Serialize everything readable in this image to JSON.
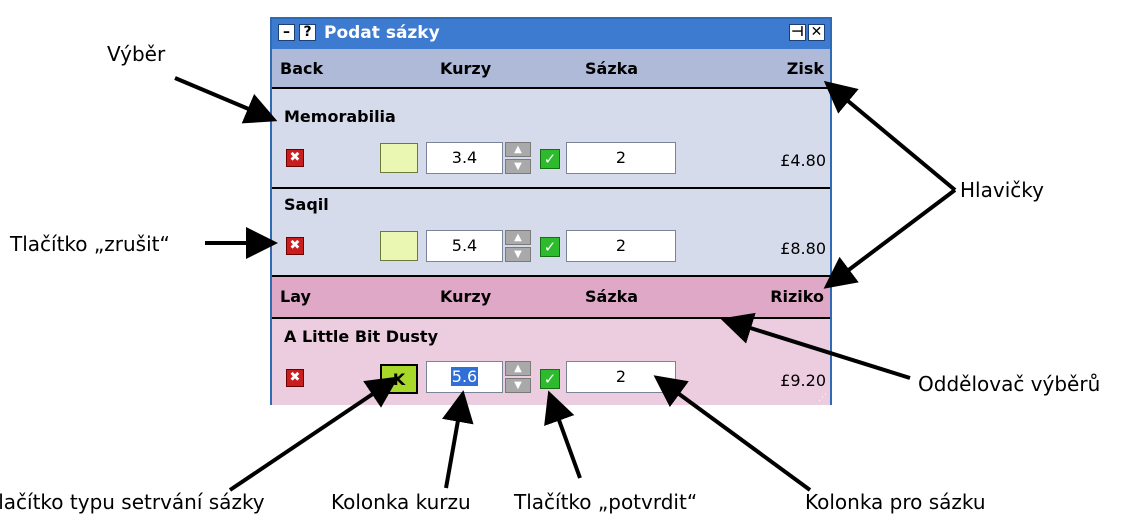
{
  "window": {
    "title": "Podat sázky",
    "buttons": {
      "minimize": "–",
      "help": "?",
      "pin": "⊣",
      "close": "✕"
    }
  },
  "back_section": {
    "headers": {
      "type": "Back",
      "odds": "Kurzy",
      "stake": "Sázka",
      "result": "Zisk"
    },
    "selections": [
      {
        "name": "Memorabilia",
        "odds": "3.4",
        "stake": "2",
        "profit": "£4.80",
        "persistence": ""
      },
      {
        "name": "Saqil",
        "odds": "5.4",
        "stake": "2",
        "profit": "£8.80",
        "persistence": ""
      }
    ]
  },
  "lay_section": {
    "headers": {
      "type": "Lay",
      "odds": "Kurzy",
      "stake": "Sázka",
      "result": "Riziko"
    },
    "selections": [
      {
        "name": "A Little Bit Dusty",
        "odds": "5.6",
        "stake": "2",
        "liability": "£9.20",
        "persistence": "K"
      }
    ]
  },
  "annotations": {
    "selection": "Výběr",
    "cancel_button": "Tlačítko „zrušit“",
    "headers": "Hlavičky",
    "separator": "Oddělovač výběrů",
    "persistence_button": "Tlačítko typu setrvání sázky",
    "odds_field": "Kolonka kurzu",
    "confirm_button": "Tlačítko „potvrdit“",
    "stake_field": "Kolonka pro sázku"
  },
  "colors": {
    "titlebar": "#3d7bd0",
    "back_header": "#aebad7",
    "back_body": "#d5dbeb",
    "lay_header": "#dfa8c6",
    "lay_body": "#ecccdf",
    "cancel": "#c81e1e",
    "confirm": "#2dbb2d"
  }
}
